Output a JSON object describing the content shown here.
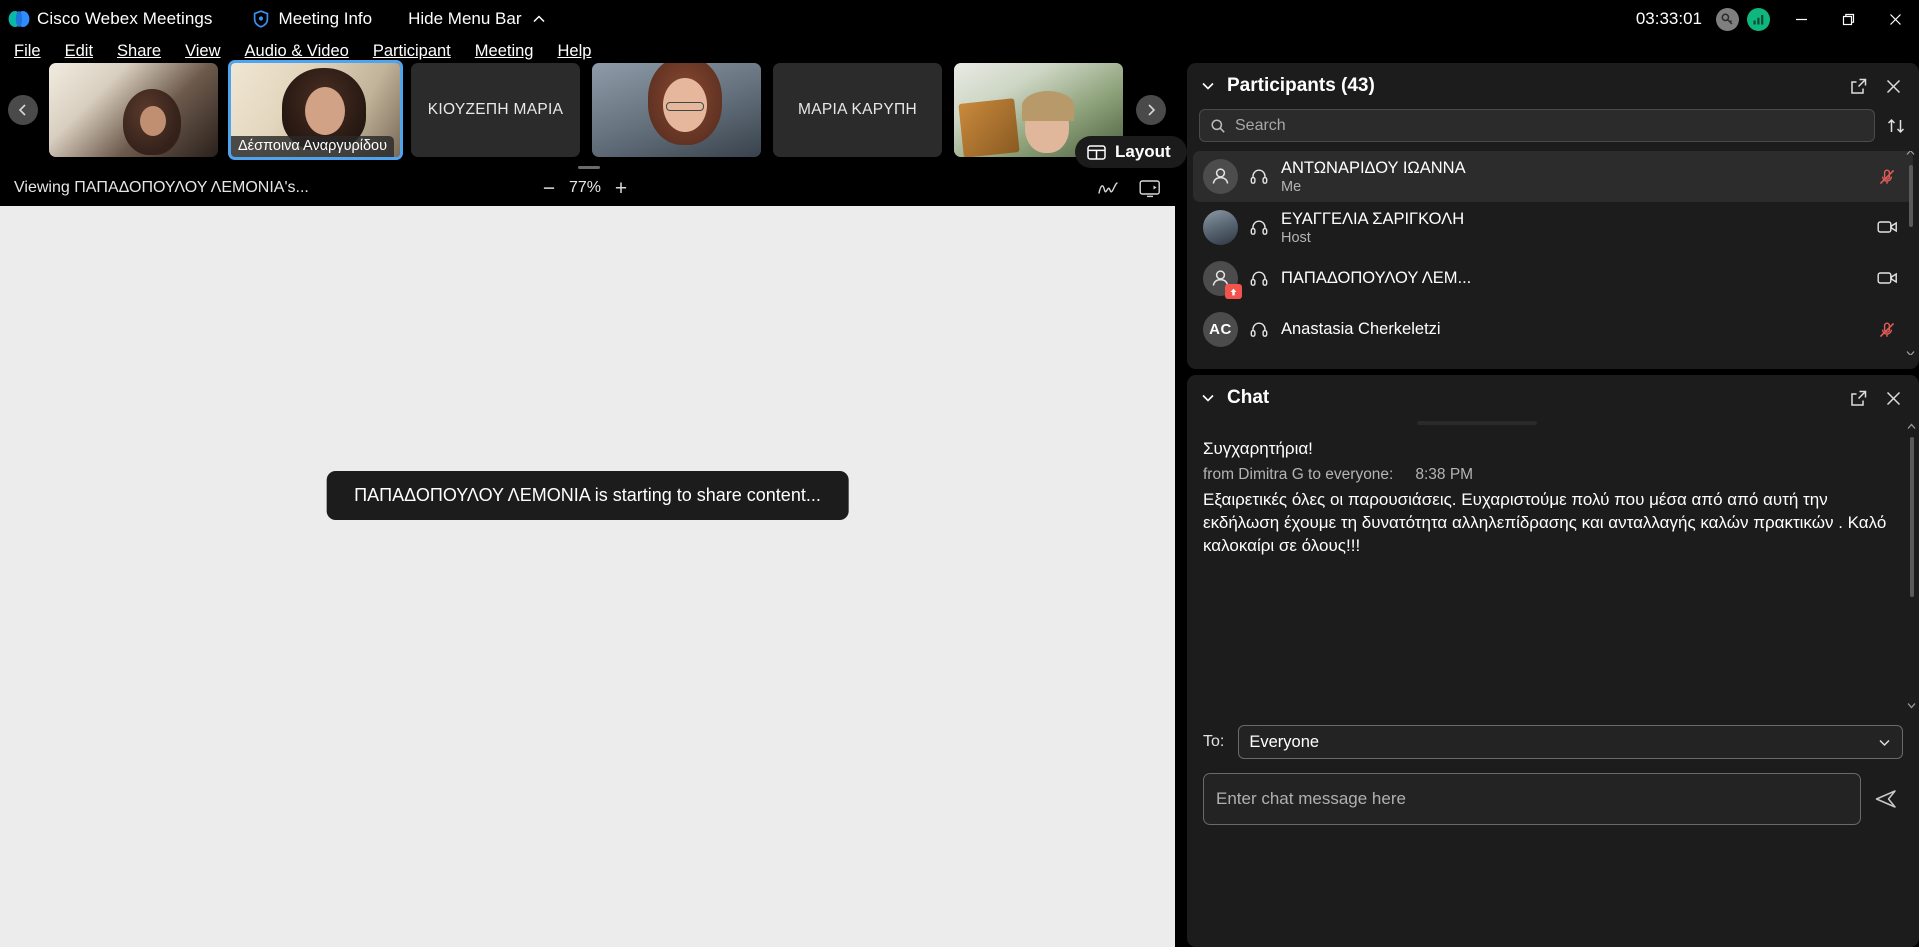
{
  "titlebar": {
    "app_name": "Cisco Webex Meetings",
    "meeting_info": "Meeting Info",
    "hide_menu_bar": "Hide Menu Bar",
    "timer": "03:33:01",
    "logo_icon": "webex-logo-icon",
    "shield_icon": "shield-icon",
    "collapse_icon": "chevron-up-icon",
    "key_icon": "meeting-key-icon",
    "signal_icon": "network-signal-icon",
    "minimize_icon": "minimize-icon",
    "maximize_icon": "restore-icon",
    "close_icon": "close-icon",
    "colors": {
      "signal_green": "#0fb77f",
      "key_gray": "#7f7f7f"
    }
  },
  "menubar": {
    "items": [
      {
        "label": "File",
        "mnemonic": "F"
      },
      {
        "label": "Edit",
        "mnemonic": "E"
      },
      {
        "label": "Share",
        "mnemonic": "S"
      },
      {
        "label": "View",
        "mnemonic": "V"
      },
      {
        "label": "Audio & Video",
        "mnemonic": "A"
      },
      {
        "label": "Participant",
        "mnemonic": "P"
      },
      {
        "label": "Meeting",
        "mnemonic": "M"
      },
      {
        "label": "Help",
        "mnemonic": "H"
      }
    ]
  },
  "video_strip": {
    "prev_arrow": "chevron-left-icon",
    "next_arrow": "chevron-right-icon",
    "layout_button": {
      "label": "Layout",
      "icon": "layout-grid-icon"
    },
    "thumbnails": [
      {
        "name": "",
        "has_video": true,
        "selected": false,
        "label_visible": false
      },
      {
        "name": "Δέσποινα Αναργυρίδου",
        "has_video": true,
        "selected": true,
        "label_visible": true
      },
      {
        "name": "ΚΙΟΥΖΕΠΗ ΜΑΡΙΑ",
        "has_video": false,
        "selected": false,
        "label_visible": true
      },
      {
        "name": "",
        "has_video": true,
        "selected": false,
        "label_visible": false
      },
      {
        "name": "ΜΑΡΙΑ ΚΑΡΥΠΗ",
        "has_video": false,
        "selected": false,
        "label_visible": true
      },
      {
        "name": "",
        "has_video": true,
        "selected": false,
        "label_visible": false
      }
    ]
  },
  "viewbar": {
    "viewing_text": "Viewing ΠΑΠΑΔΟΠΟΥΛΟΥ ΛΕΜΟΝΙΑ's...",
    "zoom_out": "−",
    "zoom_level": "77%",
    "zoom_in": "+",
    "annotate_icon": "annotate-pen-icon",
    "fullscreen_icon": "share-screen-icon"
  },
  "stage": {
    "share_toast": "ΠΑΠΑΔΟΠΟΥΛΟΥ ΛΕΜΟΝΙΑ is starting to share content..."
  },
  "participants": {
    "title": "Participants (43)",
    "count": 43,
    "collapse_icon": "chevron-down-icon",
    "popout_icon": "popout-icon",
    "close_icon": "close-icon",
    "search": {
      "placeholder": "Search",
      "value": "",
      "icon": "search-icon"
    },
    "sort_icon": "sort-icon",
    "list": [
      {
        "name": "ΑΝΤΩΝΑΡΙΔΟΥ ΙΩΑΝΝΑ",
        "role": "Me",
        "avatar_type": "silhouette",
        "initials": "",
        "audio_icon": "headset-icon",
        "status_icon": "mic-muted-icon",
        "is_me": true
      },
      {
        "name": "ΕΥΑΓΓΕΛΙΑ ΣΑΡΙΓΚΟΛΗ",
        "role": "Host",
        "avatar_type": "photo",
        "initials": "",
        "audio_icon": "headset-icon",
        "status_icon": "camera-icon",
        "is_me": false
      },
      {
        "name": "ΠΑΠΑΔΟΠΟΥΛΟΥ ΛΕΜ...",
        "role": "",
        "avatar_type": "silhouette",
        "initials": "",
        "audio_icon": "headset-icon",
        "status_icon": "camera-icon",
        "badge_icon": "sharing-badge-icon",
        "is_me": false
      },
      {
        "name": "Anastasia Cherkeletzi",
        "role": "",
        "avatar_type": "initials",
        "initials": "AC",
        "audio_icon": "headset-icon",
        "status_icon": "mic-muted-icon",
        "is_me": false
      }
    ],
    "scroll_up_icon": "chevron-up-icon",
    "scroll_down_icon": "chevron-down-icon"
  },
  "chat": {
    "title": "Chat",
    "collapse_icon": "chevron-down-icon",
    "popout_icon": "popout-icon",
    "close_icon": "close-icon",
    "messages": [
      {
        "type": "text",
        "body": "Συγχαρητήρια!"
      },
      {
        "type": "header",
        "from": "from Dimitra G to everyone:",
        "time": "8:38 PM"
      },
      {
        "type": "text",
        "body": "Εξαιρετικές όλες οι παρουσιάσεις. Ευχαριστούμε πολύ που μέσα από από αυτή την εκδήλωση έχουμε τη δυνατότητα αλληλεπίδρασης και ανταλλαγής καλών πρακτικών . Καλό καλοκαίρι σε όλους!!!"
      }
    ],
    "to_label": "To:",
    "to_value": "Everyone",
    "to_caret": "chevron-down-icon",
    "compose": {
      "placeholder": "Enter chat message here",
      "value": ""
    },
    "send_icon": "send-icon"
  }
}
